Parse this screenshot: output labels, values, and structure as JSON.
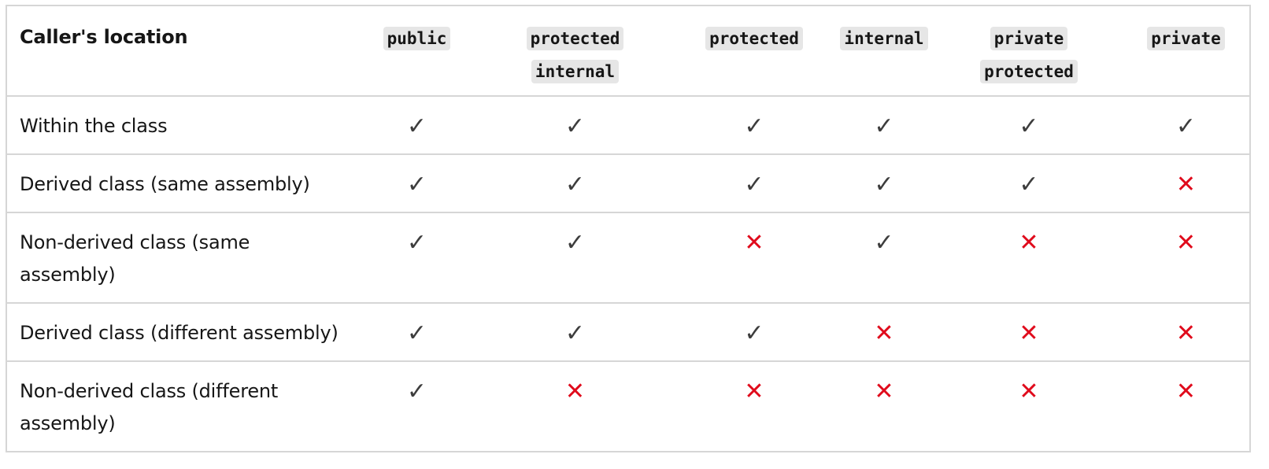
{
  "table": {
    "header": {
      "location_label": "Caller's location",
      "modifiers": [
        {
          "line1": "public",
          "line2": ""
        },
        {
          "line1": "protected",
          "line2": "internal"
        },
        {
          "line1": "protected",
          "line2": ""
        },
        {
          "line1": "internal",
          "line2": ""
        },
        {
          "line1": "private",
          "line2": "protected"
        },
        {
          "line1": "private",
          "line2": ""
        }
      ]
    },
    "rows": [
      {
        "location": "Within the class",
        "cells": [
          "✓",
          "✓",
          "✓",
          "✓",
          "✓",
          "✓"
        ]
      },
      {
        "location": "Derived class (same assembly)",
        "cells": [
          "✓",
          "✓",
          "✓",
          "✓",
          "✓",
          "✕"
        ]
      },
      {
        "location": "Non-derived class (same assembly)",
        "cells": [
          "✓",
          "✓",
          "✕",
          "✓",
          "✕",
          "✕"
        ]
      },
      {
        "location": "Derived class (different assembly)",
        "cells": [
          "✓",
          "✓",
          "✓",
          "✕",
          "✕",
          "✕"
        ]
      },
      {
        "location": "Non-derived class (different assembly)",
        "cells": [
          "✓",
          "✕",
          "✕",
          "✕",
          "✕",
          "✕"
        ]
      }
    ]
  },
  "colors": {
    "check": "#3d3d3d",
    "cross": "#e00b1c",
    "border": "#d6d6d6",
    "code_bg": "#e6e6e6"
  }
}
